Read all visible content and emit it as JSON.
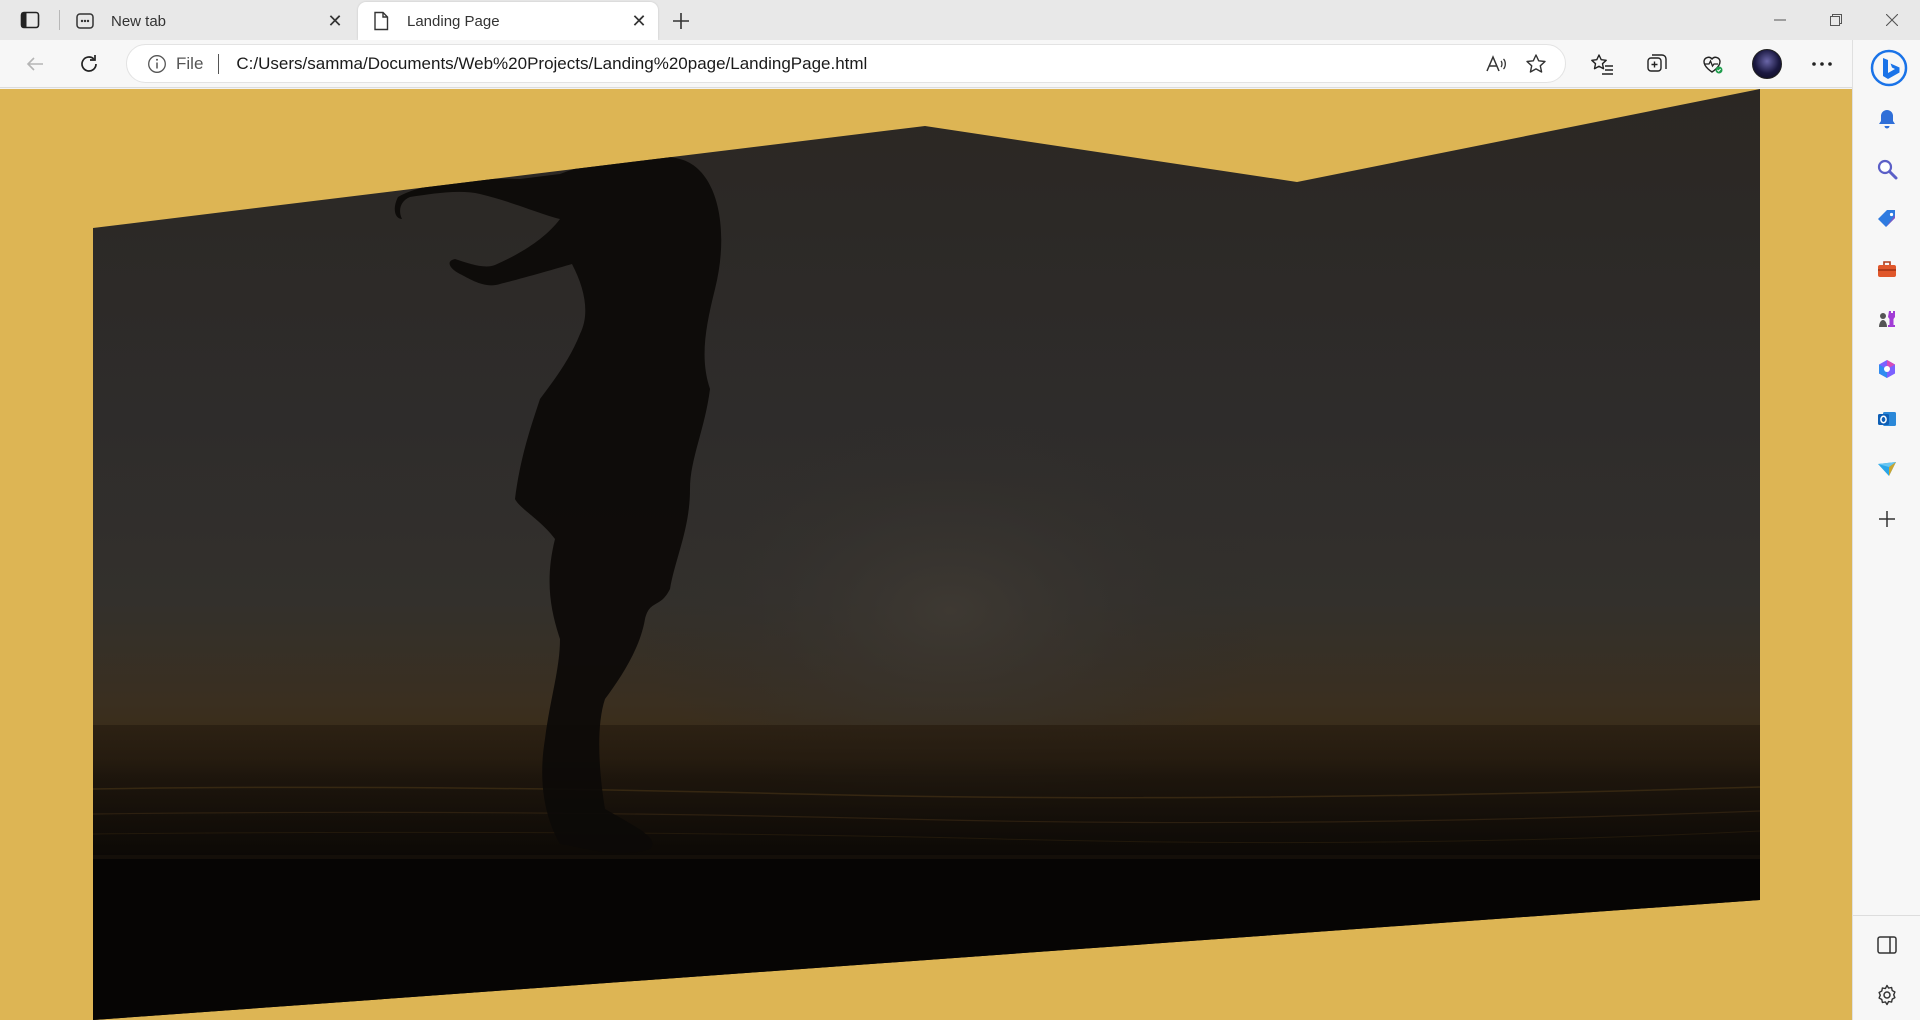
{
  "browser": {
    "tabs": [
      {
        "label": "New tab",
        "icon": "new-tab-page-icon",
        "active": false
      },
      {
        "label": "Landing Page",
        "icon": "document-icon",
        "active": true
      }
    ],
    "address": {
      "scheme_label": "File",
      "url": "C:/Users/samma/Documents/Web%20Projects/Landing%20page/LandingPage.html"
    },
    "toolbar_icons": [
      "read-aloud-icon",
      "favorite-star-icon",
      "favorites-icon",
      "collections-icon",
      "browser-essentials-icon",
      "profile-avatar",
      "more-menu-icon"
    ],
    "sidebar_icons": [
      "notifications-bell-icon",
      "search-icon",
      "shopping-tag-icon",
      "tools-briefcase-icon",
      "games-icon",
      "microsoft-365-icon",
      "outlook-icon",
      "drop-icon",
      "add-icon"
    ],
    "sidebar_bottom_icons": [
      "hide-sidebar-icon",
      "settings-gear-icon"
    ]
  },
  "page": {
    "background_color": "#ddb554",
    "hero": {
      "image_subject": "silhouette of a person on a beach at sunset",
      "shape": "skewed-polygon"
    }
  }
}
